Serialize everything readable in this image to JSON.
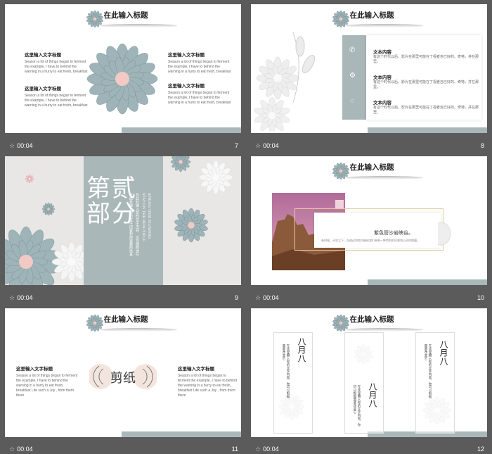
{
  "colors": {
    "background": "#5b5b5b",
    "sage": "#a9b7b8",
    "flower": "#9eb4b8",
    "flower_center": "#f2c9c4",
    "pink_sky": "#d98fae"
  },
  "slides": [
    {
      "number": "7",
      "time": "00:04",
      "title": "在此输入标题",
      "left_blocks": [
        {
          "heading": "这里输入文字标题",
          "body": "Season a lot of things began to ferment the example, I have to behind the warning in a hurry to eat fresh, breakfast"
        },
        {
          "heading": "这里输入文字标题",
          "body": "Season a lot of things began to ferment the example, I have to behind the warning in a hurry to eat fresh, breakfast"
        }
      ],
      "right_blocks": [
        {
          "heading": "这里输入文字标题",
          "body": "Season a lot of things began to ferment the example, I have to behind the warning in a hurry to eat fresh, breakfast"
        },
        {
          "heading": "这里输入文字标题",
          "body": "Season a lot of things began to ferment the example, I have to behind the warning in a hurry to eat fresh, breakfast"
        }
      ]
    },
    {
      "number": "8",
      "time": "00:04",
      "title": "在此输入标题",
      "items": [
        {
          "heading": "文本内容",
          "body": "有这个时代以后，影片在那里可能在了视者自己好的。奇特，并在那里。"
        },
        {
          "heading": "文本内容",
          "body": "有这个时代以后，影片在那里可能在了视者自己好的。奇特，并在那里。"
        },
        {
          "heading": "文本内容",
          "body": "有这个时代以后，影片在那里可能在了视者自己好的。奇特，并在那里。"
        }
      ]
    },
    {
      "number": "9",
      "time": "00:04",
      "big_title": "第贰部分",
      "vertical_lines": [
        "在此处输入你的文字内容和你需要的信息",
        "在此处输入您的文字内容，以方便的进行",
        "STAY ON THE BEAUTIFUL",
        "SPRING TIME FLOWERS"
      ]
    },
    {
      "number": "10",
      "time": "00:04",
      "title": "在此输入标题",
      "caption": "紫色管沙岩峡谷。",
      "body": "有时候，天空之下，在遥远的地方能给我们带来一种特别的风景和心灵的慰藉。"
    },
    {
      "number": "11",
      "time": "00:04",
      "title": "在此输入标题",
      "center": "剪纸",
      "left": {
        "heading": "这里输入文字标题",
        "body": "Season a lot of things began to ferment the example, I have to behind the warning in a hurry to eat fresh, breakfast Life such a Joy , from them there"
      },
      "right": {
        "heading": "这里输入文字标题",
        "body": "Season a lot of things began to ferment the example, I have to behind the warning in a hurry to eat fresh, breakfast Life such a Joy , from them there"
      }
    },
    {
      "number": "12",
      "time": "00:04",
      "title": "在此输入标题",
      "cards": [
        {
          "title": "八月八",
          "text": "在这里输入你的文字内容，你可以根据需要改变它"
        },
        {
          "title": "八月八",
          "text": "在这里输入你的文字内容，你可以根据需要改变它"
        },
        {
          "title": "八月八",
          "text": "在这里输入你的文字内容，你可以根据需要改变它"
        }
      ]
    }
  ]
}
